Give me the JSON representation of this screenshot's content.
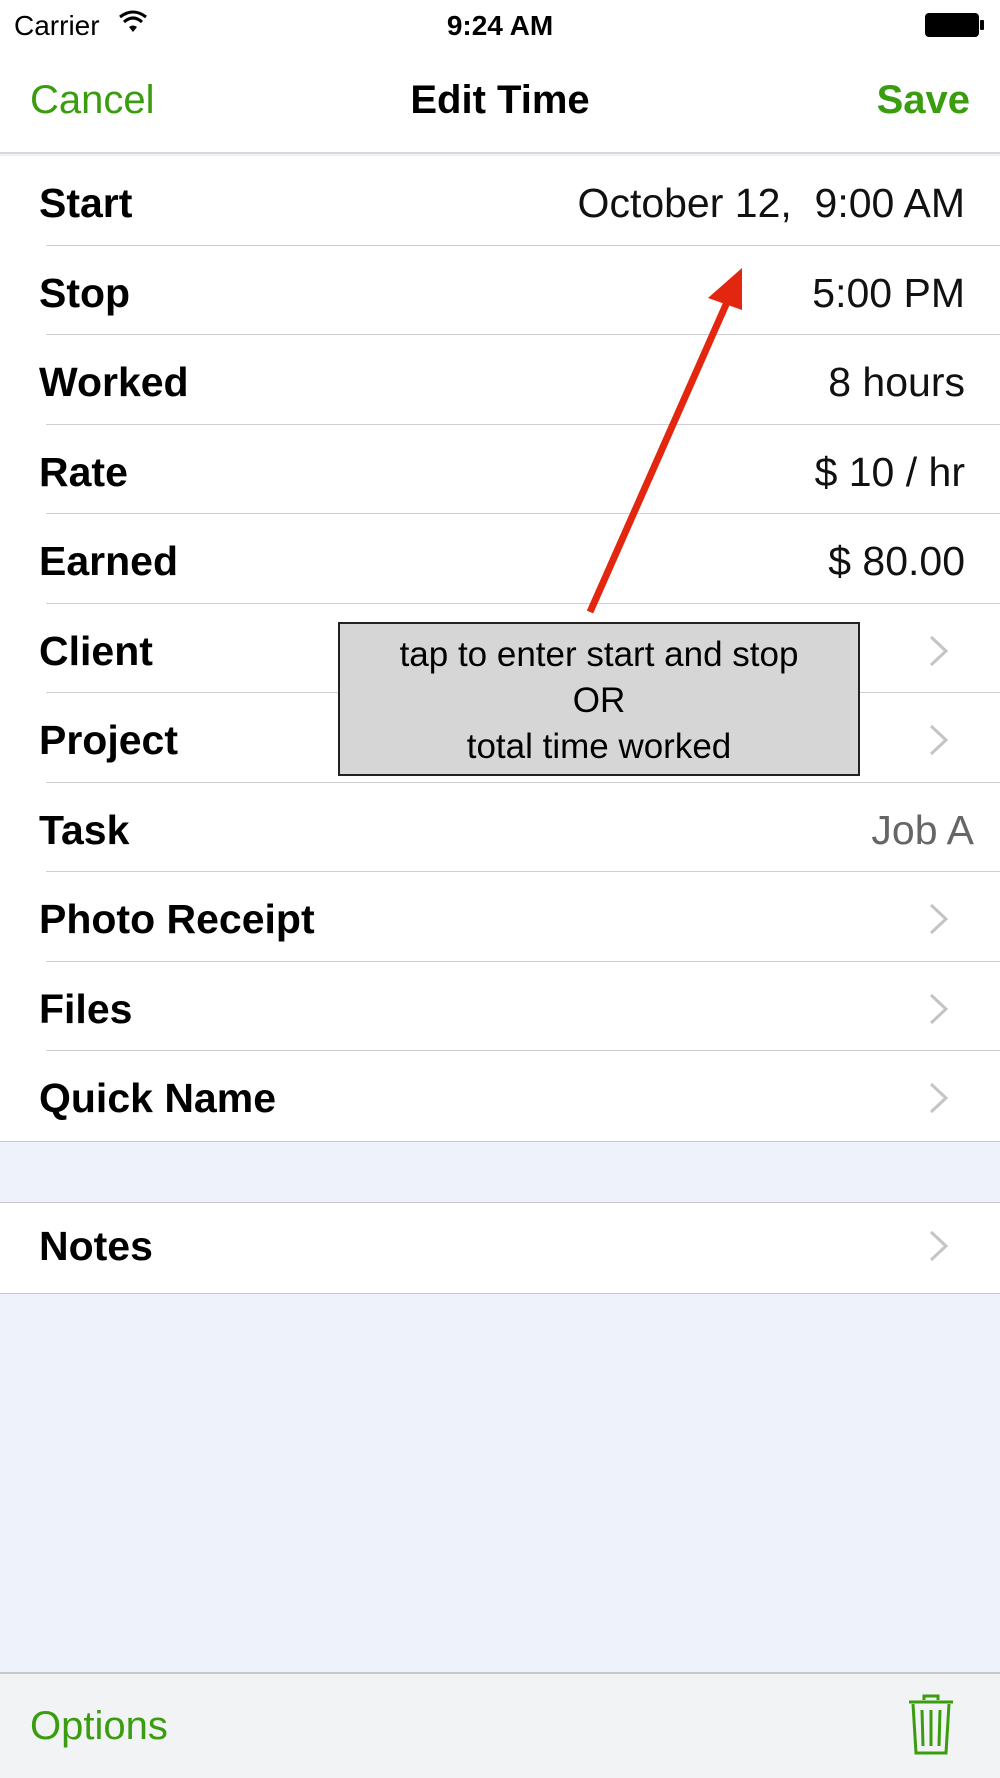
{
  "status_bar": {
    "carrier": "Carrier",
    "time": "9:24 AM"
  },
  "nav": {
    "cancel": "Cancel",
    "title": "Edit Time",
    "save": "Save"
  },
  "rows": [
    {
      "label": "Start",
      "value": "October 12,  9:00 AM"
    },
    {
      "label": "Stop",
      "value": "5:00 PM"
    },
    {
      "label": "Worked",
      "value": "8 hours"
    },
    {
      "label": "Rate",
      "value": "$ 10 / hr"
    },
    {
      "label": "Earned",
      "value": "$ 80.00"
    },
    {
      "label": "Client",
      "value": ""
    },
    {
      "label": "Project",
      "value": ""
    },
    {
      "label": "Task",
      "value": "Job A"
    },
    {
      "label": "Photo Receipt",
      "value": ""
    },
    {
      "label": "Files",
      "value": ""
    },
    {
      "label": "Quick Name",
      "value": ""
    }
  ],
  "notes": {
    "label": "Notes"
  },
  "toolbar": {
    "options": "Options"
  },
  "annotation": {
    "line1": "tap to enter start and stop",
    "line2": "OR",
    "line3": "total time worked"
  },
  "colors": {
    "accent": "#3a9d10",
    "arrow": "#e3260f"
  },
  "icons": [
    "wifi-icon",
    "battery-icon",
    "chevron-right-icon",
    "trash-icon"
  ]
}
